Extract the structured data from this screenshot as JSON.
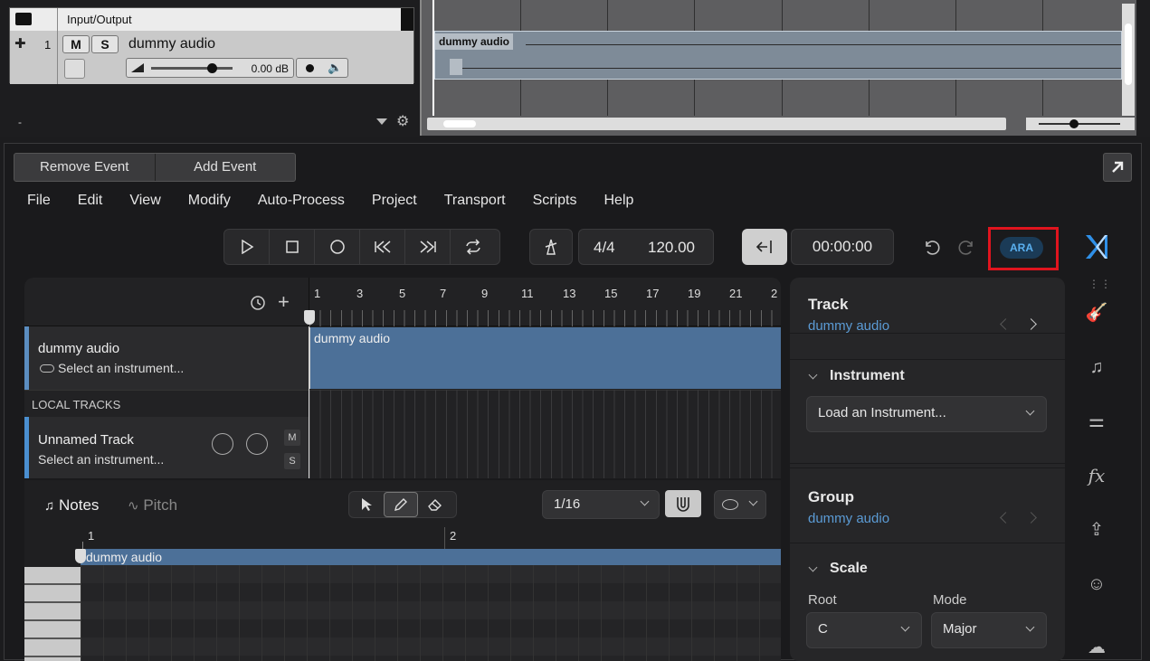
{
  "host": {
    "io_label": "Input/Output",
    "track_number": "1",
    "mute_label": "M",
    "solo_label": "S",
    "track_name": "dummy audio",
    "volume_db": "0.00 dB",
    "volume_level": 0.75,
    "bottom_left_text": "-",
    "clip_name": "dummy audio"
  },
  "plugin": {
    "event_buttons": {
      "remove": "Remove Event",
      "add": "Add Event"
    },
    "menu": [
      "File",
      "Edit",
      "View",
      "Modify",
      "Auto-Process",
      "Project",
      "Transport",
      "Scripts",
      "Help"
    ],
    "time_signature": "4/4",
    "tempo": "120.00",
    "time_display": "00:00:00",
    "ara_badge": "ARA",
    "ruler_ticks": [
      "1",
      "3",
      "5",
      "7",
      "9",
      "11",
      "13",
      "15",
      "17",
      "19",
      "21",
      "2"
    ],
    "tracks": [
      {
        "name": "dummy audio",
        "instrument": "Select an instrument...",
        "clip": "dummy audio"
      }
    ],
    "local_tracks_label": "LOCAL TRACKS",
    "local_tracks": [
      {
        "name": "Unnamed Track",
        "instrument": "Select an instrument...",
        "mute": "M",
        "solo": "S"
      }
    ],
    "editor": {
      "notes_tab": "Notes",
      "pitch_tab": "Pitch",
      "grid_value": "1/16",
      "ruler": [
        "1",
        "2"
      ],
      "clip": "dummy audio"
    },
    "right_panel": {
      "track_title": "Track",
      "track_sub": "dummy audio",
      "instrument_title": "Instrument",
      "instrument_dropdown": "Load an Instrument...",
      "group_title": "Group",
      "group_sub": "dummy audio",
      "scale_title": "Scale",
      "root_label": "Root",
      "mode_label": "Mode",
      "root_value": "C",
      "mode_value": "Major"
    },
    "colors": {
      "accent_blue": "#5b9bd5",
      "clip_blue": "#4c7098",
      "highlight_red": "#e0141e"
    }
  }
}
